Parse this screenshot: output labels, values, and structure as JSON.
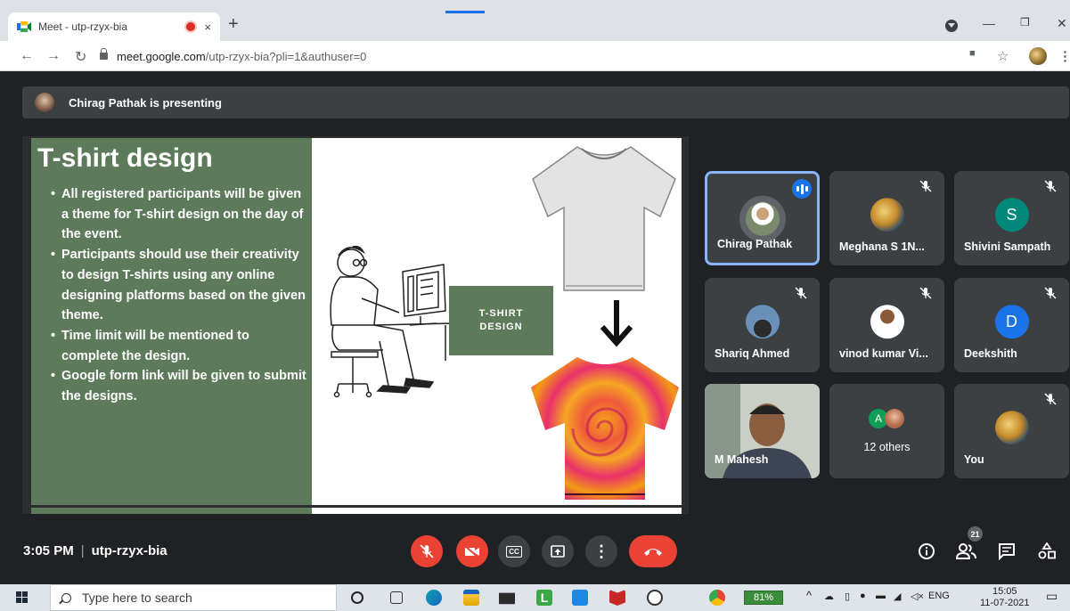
{
  "browser": {
    "tab_title": "Meet - utp-rzyx-bia",
    "url_domain": "meet.google.com",
    "url_path": "/utp-rzyx-bia?pli=1&authuser=0",
    "new_tab": "+",
    "tab_close": "×"
  },
  "presenting": {
    "text": "Chirag Pathak is presenting"
  },
  "slide": {
    "title": "T-shirt design",
    "bullets": [
      "All registered participants will be given a theme for T-shirt design on the day of the event.",
      "Participants should use their creativity to design T-shirts using any online designing platforms based on the given theme.",
      "Time limit will be mentioned to complete the design.",
      "Google form link will be given to submit the designs."
    ],
    "box_line1": "T-SHIRT",
    "box_line2": "DESIGN"
  },
  "participants": [
    {
      "name": "Chirag Pathak",
      "speaking": true
    },
    {
      "name": "Meghana S 1N...",
      "muted": true
    },
    {
      "name": "Shivini Sampath",
      "initial": "S",
      "color": "#1a73e8",
      "muted": true
    },
    {
      "name": "Shariq Ahmed",
      "muted": true
    },
    {
      "name": "vinod kumar Vi...",
      "muted": true
    },
    {
      "name": "Deekshith",
      "initial": "D",
      "color": "#1a73e8",
      "muted": true
    },
    {
      "name": "M Mahesh",
      "video": true
    },
    {
      "name": "12 others",
      "initial": "A",
      "color": "#0f9d58"
    },
    {
      "name": "You",
      "muted": true
    }
  ],
  "meeting": {
    "time": "3:05 PM",
    "code": "utp-rzyx-bia",
    "participant_count": "21"
  },
  "taskbar": {
    "search_placeholder": "Type here to search",
    "battery": "81%",
    "language": "ENG",
    "time": "15:05",
    "date": "11-07-2021"
  },
  "colors": {
    "slide_green": "#5d7a5a",
    "meet_red": "#ea4335",
    "meet_blue": "#1a73e8"
  }
}
